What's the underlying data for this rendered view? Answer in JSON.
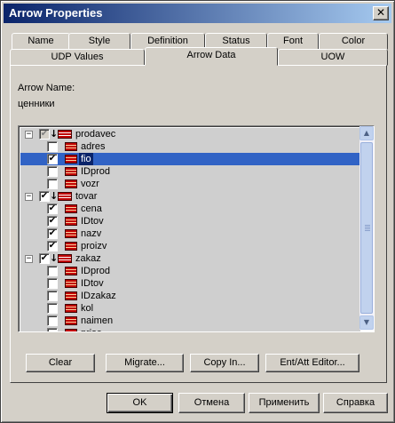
{
  "window": {
    "title": "Arrow Properties"
  },
  "tabs_back": [
    {
      "label": "Name"
    },
    {
      "label": "Style"
    },
    {
      "label": "Definition"
    },
    {
      "label": "Status"
    },
    {
      "label": "Font"
    },
    {
      "label": "Color"
    }
  ],
  "tabs_front": [
    {
      "label": "UDP Values"
    },
    {
      "label": "Arrow Data",
      "active": true
    },
    {
      "label": "UOW"
    }
  ],
  "arrow_name": {
    "label": "Arrow Name:",
    "value": "ценники"
  },
  "tree": {
    "rows": [
      {
        "label": "prodavec",
        "type": "entity",
        "expanded": true,
        "checked": "partial-grey"
      },
      {
        "label": "adres",
        "type": "attribute",
        "checked": false
      },
      {
        "label": "fio",
        "type": "attribute",
        "checked": true,
        "selected": true
      },
      {
        "label": "IDprod",
        "type": "attribute",
        "checked": false
      },
      {
        "label": "vozr",
        "type": "attribute",
        "checked": false
      },
      {
        "label": "tovar",
        "type": "entity",
        "expanded": true,
        "checked": true
      },
      {
        "label": "cena",
        "type": "attribute",
        "checked": true
      },
      {
        "label": "IDtov",
        "type": "attribute",
        "checked": true
      },
      {
        "label": "nazv",
        "type": "attribute",
        "checked": true
      },
      {
        "label": "proizv",
        "type": "attribute",
        "checked": true
      },
      {
        "label": "zakaz",
        "type": "entity",
        "expanded": true,
        "checked": true
      },
      {
        "label": "IDprod",
        "type": "attribute",
        "checked": false
      },
      {
        "label": "IDtov",
        "type": "attribute",
        "checked": false
      },
      {
        "label": "IDzakaz",
        "type": "attribute",
        "checked": false
      },
      {
        "label": "kol",
        "type": "attribute",
        "checked": false
      },
      {
        "label": "naimen",
        "type": "attribute",
        "checked": false
      },
      {
        "label": "prise",
        "type": "attribute",
        "checked": false
      }
    ]
  },
  "panel_buttons": {
    "clear": "Clear",
    "migrate": "Migrate...",
    "copy_in": "Copy In...",
    "editor": "Ent/Att Editor..."
  },
  "dialog_buttons": {
    "ok": "OK",
    "cancel": "Отмена",
    "apply": "Применить",
    "help": "Справка"
  },
  "icons": {
    "close": "close-icon",
    "entity": "entity-table-icon",
    "attribute": "attribute-icon",
    "arrow_marker": "arrow-down-icon"
  },
  "colors": {
    "title_start": "#0a246a",
    "title_end": "#a6caf0",
    "selection": "#0a246a",
    "entity_icon": "#c00000",
    "row_bg": "#cfcfcf"
  }
}
